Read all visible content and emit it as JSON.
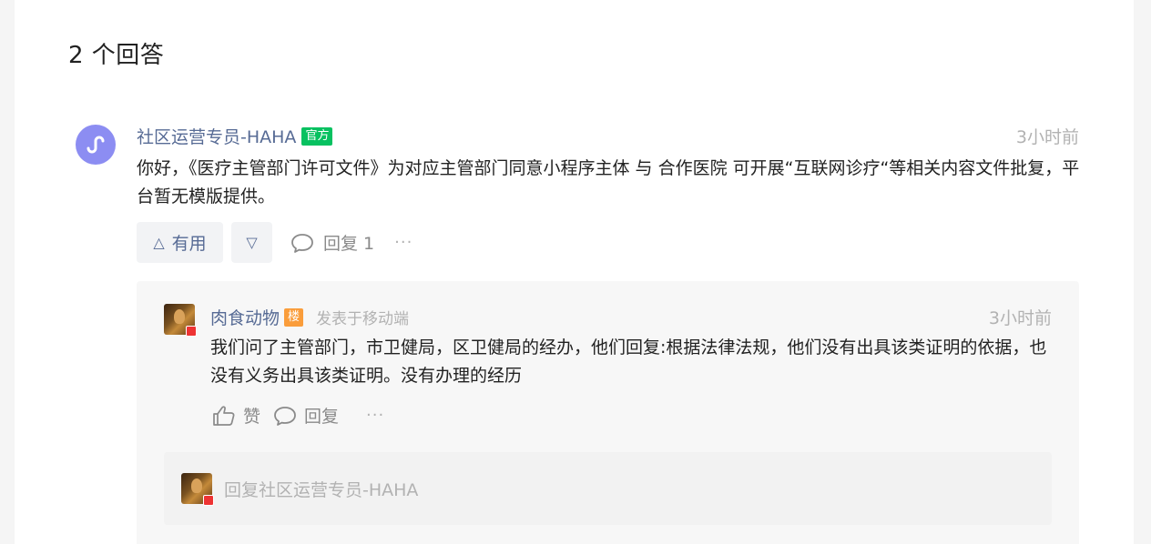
{
  "answers": {
    "title": "2 个回答"
  },
  "main_answer": {
    "avatar_icon": "mini-program-icon",
    "author": "社区运营专员-HAHA",
    "badge": "官方",
    "time": "3小时前",
    "body": "你好，《医疗主管部门许可文件》为对应主管部门同意小程序主体 与 合作医院 可开展“互联网诊疗“等相关内容文件批复，平台暂无模版提供。",
    "useful_label": "有用",
    "reply_label": "回复 1",
    "more_label": "···"
  },
  "reply": {
    "author": "肉食动物",
    "badge": "楼",
    "source": "发表于移动端",
    "time": "3小时前",
    "body": "我们问了主管部门，市卫健局，区卫健局的经办，他们回复:根据法律法规，他们没有出具该类证明的依据，也没有义务出具该类证明。没有办理的经历",
    "like_label": "赞",
    "reply_label": "回复",
    "more_label": "···"
  },
  "reply_input": {
    "placeholder": "回复社区运营专员-HAHA"
  },
  "colors": {
    "link": "#576b95",
    "official_badge": "#07c160",
    "floor_badge": "#fa9d3b",
    "avatar_main": "#8c8df2"
  }
}
